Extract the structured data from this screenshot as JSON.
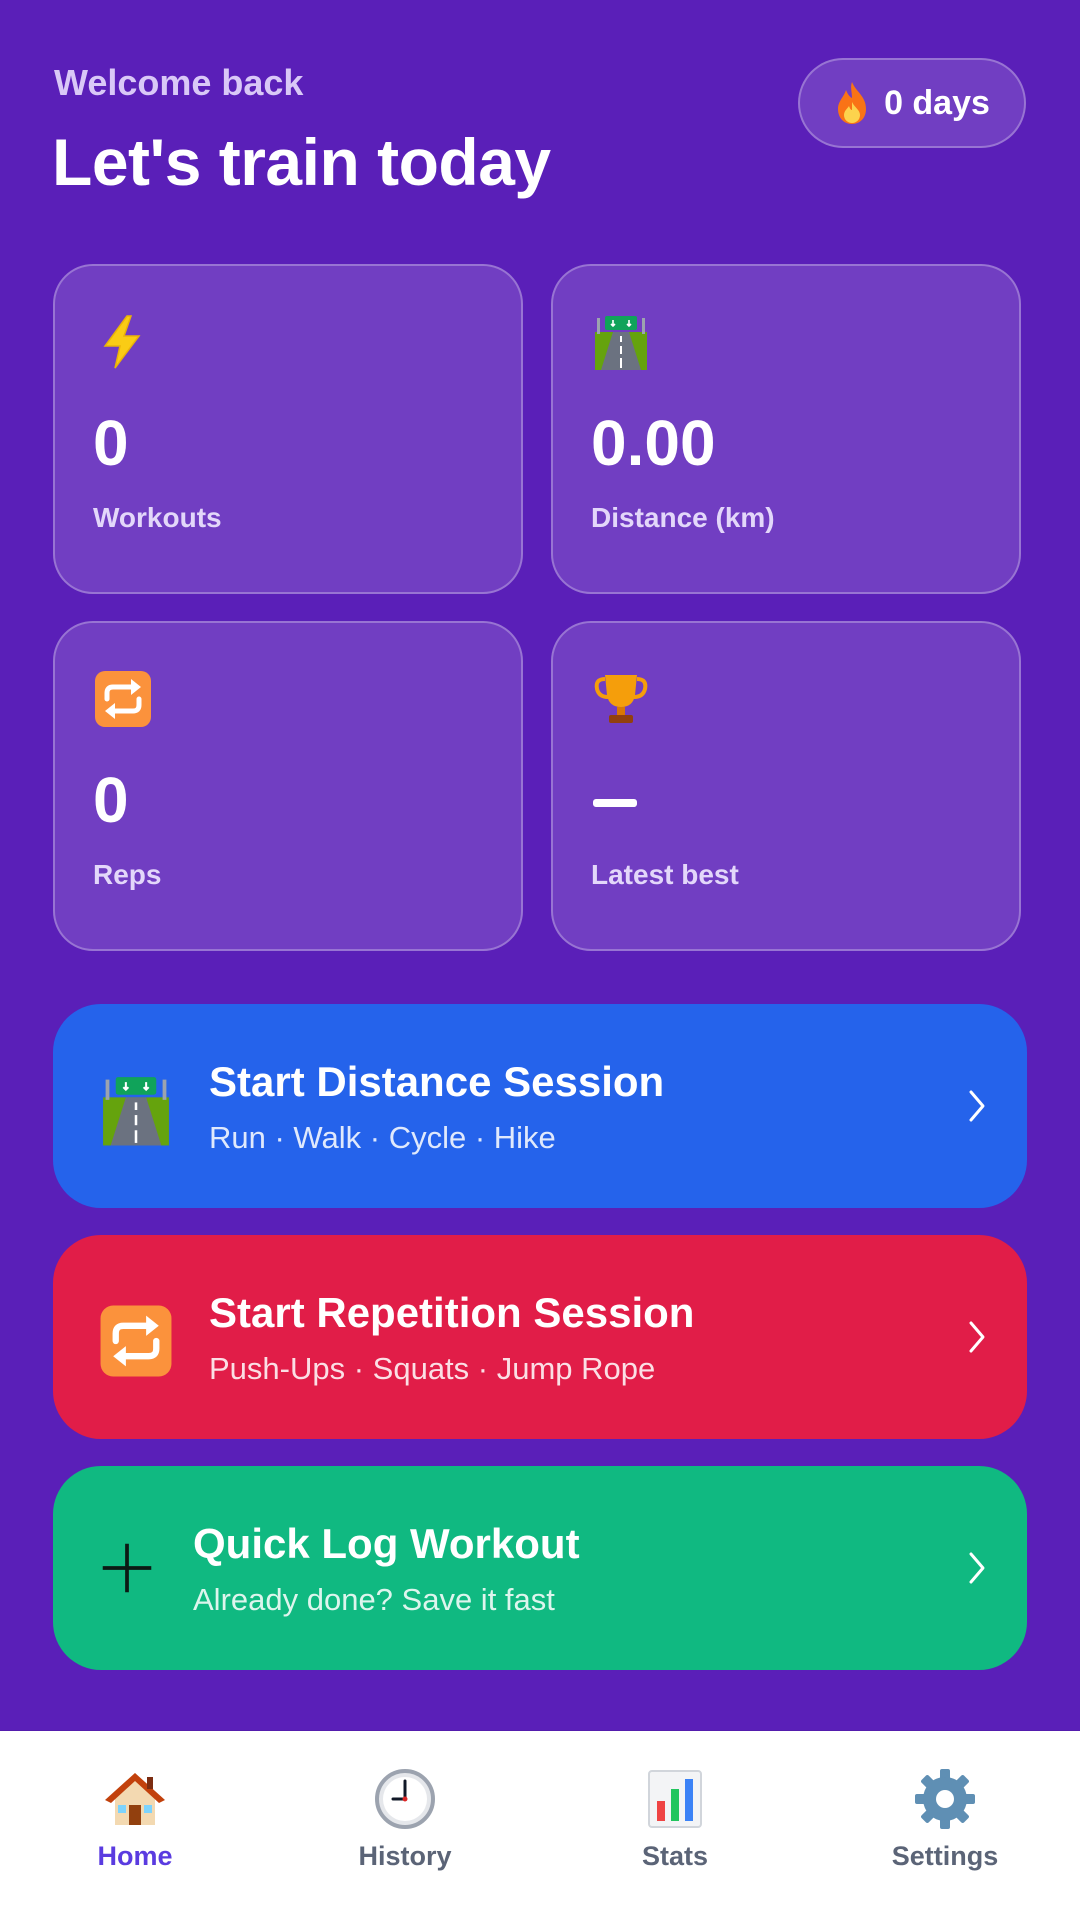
{
  "header": {
    "greeting": "Welcome back",
    "title": "Let's train today",
    "streak": "0 days",
    "streak_icon": "flame-icon"
  },
  "stats": [
    {
      "icon": "lightning-icon",
      "value": "0",
      "label": "Workouts"
    },
    {
      "icon": "road-icon",
      "value": "0.00",
      "label": "Distance (km)"
    },
    {
      "icon": "repeat-icon",
      "value": "0",
      "label": "Reps"
    },
    {
      "icon": "trophy-icon",
      "value": "",
      "label": "Latest best"
    }
  ],
  "actions": [
    {
      "icon": "road-icon",
      "title": "Start Distance Session",
      "subtitle": "Run · Walk · Cycle · Hike",
      "color": "#2563eb"
    },
    {
      "icon": "repeat-icon",
      "title": "Start Repetition Session",
      "subtitle": "Push-Ups · Squats · Jump Rope",
      "color": "#e11d48"
    },
    {
      "icon": "plus-icon",
      "title": "Quick Log Workout",
      "subtitle": "Already done? Save it fast",
      "color": "#10b981"
    }
  ],
  "nav": [
    {
      "icon": "house-icon",
      "label": "Home",
      "active": true
    },
    {
      "icon": "clock-icon",
      "label": "History",
      "active": false
    },
    {
      "icon": "bar-chart-icon",
      "label": "Stats",
      "active": false
    },
    {
      "icon": "gear-icon",
      "label": "Settings",
      "active": false
    }
  ],
  "colors": {
    "background": "#5a1fb8",
    "nav_active": "#5a3be0",
    "nav_inactive": "#5b6477"
  }
}
